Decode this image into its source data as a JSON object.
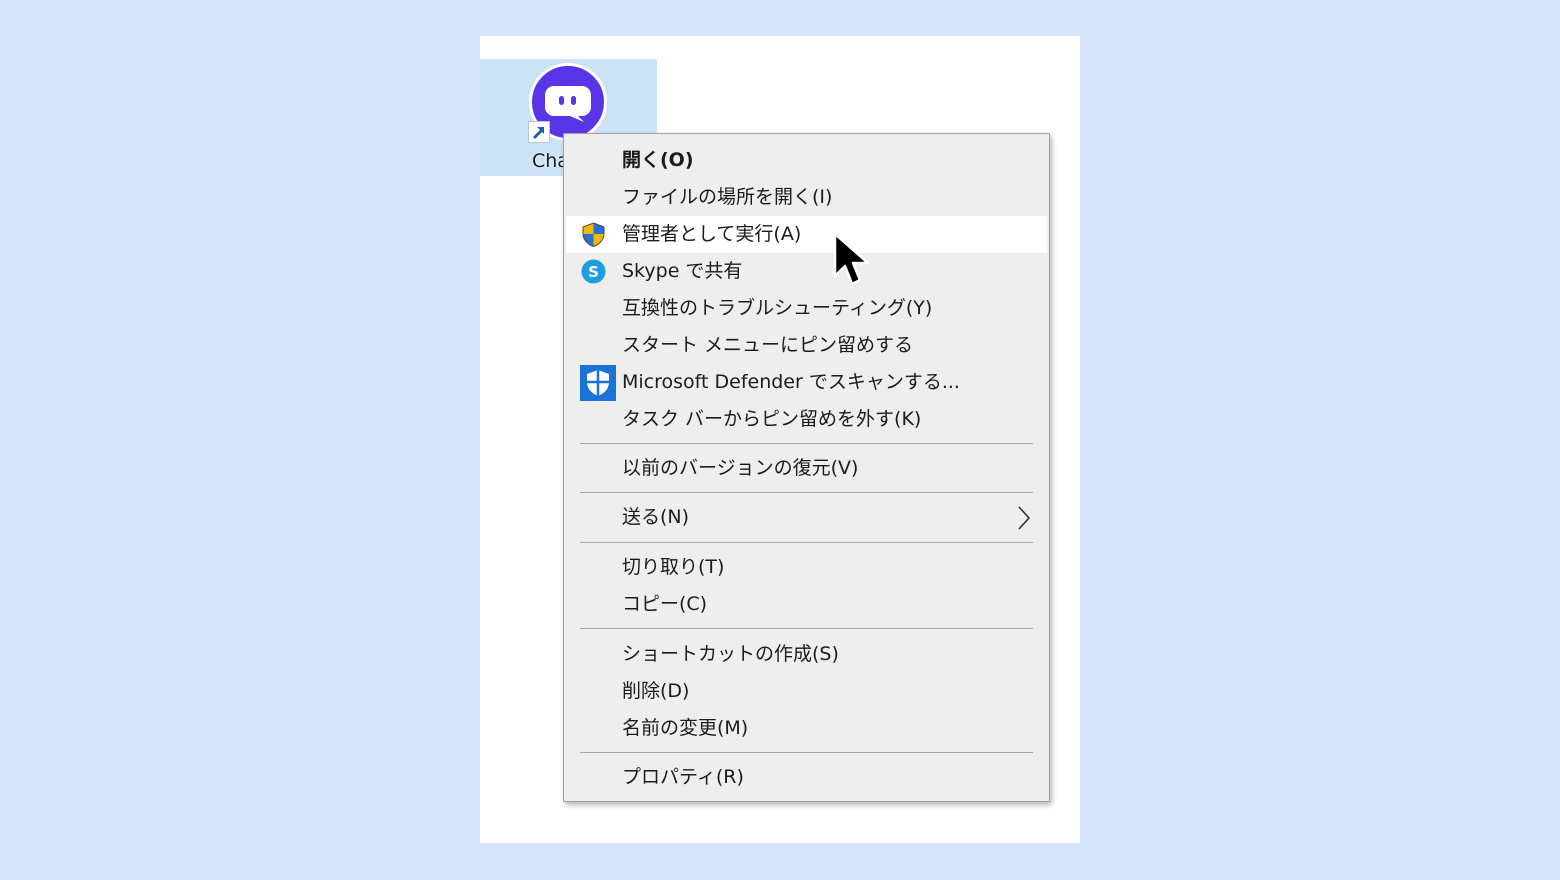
{
  "desktop": {
    "shortcut_label": "ChatGPT",
    "icon": "chat-bubble-app-icon",
    "brand_color": "#5a35e8"
  },
  "context_menu": {
    "items": [
      {
        "label": "開く(O)",
        "bold": true
      },
      {
        "label": "ファイルの場所を開く(I)"
      },
      {
        "label": "管理者として実行(A)",
        "icon": "uac-shield-icon",
        "highlighted": true
      },
      {
        "label": "Skype で共有",
        "icon": "skype-icon"
      },
      {
        "label": "互換性のトラブルシューティング(Y)"
      },
      {
        "label": "スタート メニューにピン留めする"
      },
      {
        "label": "Microsoft Defender でスキャンする...",
        "icon": "defender-shield-icon"
      },
      {
        "label": "タスク バーからピン留めを外す(K)"
      },
      {
        "label": "以前のバージョンの復元(V)"
      },
      {
        "label": "送る(N)",
        "submenu": true
      },
      {
        "label": "切り取り(T)"
      },
      {
        "label": "コピー(C)"
      },
      {
        "label": "ショートカットの作成(S)"
      },
      {
        "label": "削除(D)"
      },
      {
        "label": "名前の変更(M)"
      },
      {
        "label": "プロパティ(R)"
      }
    ]
  },
  "colors": {
    "page_background": "#d6e4fc",
    "menu_background": "#eeeeee",
    "highlight": "#ffffff",
    "selection": "#cce3f7"
  }
}
